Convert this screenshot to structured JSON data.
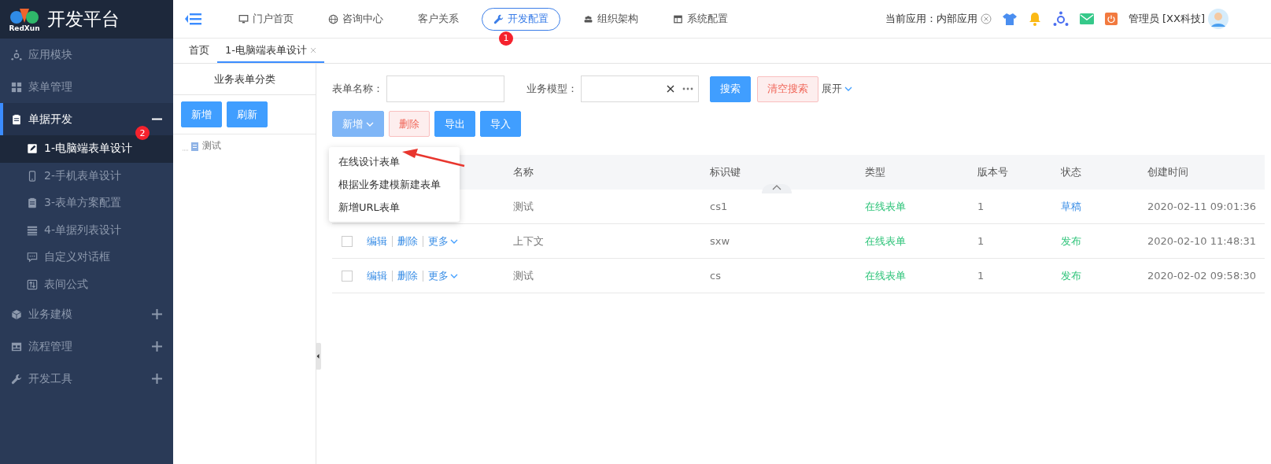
{
  "brand": {
    "logo_text": "RedXun",
    "title": "开发平台"
  },
  "nav": [
    {
      "label": "门户首页",
      "selected": false
    },
    {
      "label": "咨询中心",
      "selected": false
    },
    {
      "label": "客户关系",
      "selected": false
    },
    {
      "label": "开发配置",
      "selected": true,
      "badge": "1"
    },
    {
      "label": "组织架构",
      "selected": false
    },
    {
      "label": "系统配置",
      "selected": false
    }
  ],
  "current_app": {
    "label": "当前应用：内部应用"
  },
  "user": {
    "name": "管理员 [XX科技]"
  },
  "sidebar": [
    {
      "label": "应用模块",
      "kind": "link"
    },
    {
      "label": "菜单管理",
      "kind": "link"
    },
    {
      "label": "单据开发",
      "kind": "group",
      "expanded": true,
      "children": [
        {
          "label": "1-电脑端表单设计",
          "selected": true,
          "badge": "2"
        },
        {
          "label": "2-手机表单设计",
          "selected": false
        },
        {
          "label": "3-表单方案配置",
          "selected": false
        },
        {
          "label": "4-单据列表设计",
          "selected": false
        },
        {
          "label": "自定义对话框",
          "selected": false
        },
        {
          "label": "表间公式",
          "selected": false
        }
      ]
    },
    {
      "label": "业务建模",
      "kind": "group",
      "expanded": false
    },
    {
      "label": "流程管理",
      "kind": "group",
      "expanded": false
    },
    {
      "label": "开发工具",
      "kind": "group",
      "expanded": false
    }
  ],
  "page_tabs": [
    {
      "label": "首页",
      "selected": false,
      "closable": false
    },
    {
      "label": "1-电脑端表单设计",
      "selected": true,
      "closable": true
    }
  ],
  "tree_panel": {
    "title": "业务表单分类",
    "buttons": [
      "新增",
      "刷新"
    ],
    "nodes": [
      "测试"
    ]
  },
  "search": {
    "fields": [
      {
        "label": "表单名称：",
        "kind": "text"
      },
      {
        "label": "业务模型：",
        "kind": "picker"
      }
    ],
    "search_button": "搜索",
    "clear_button": "清空搜索",
    "expand_link": "展开"
  },
  "toolbar": [
    {
      "label": "新增",
      "kind": "dropdown"
    },
    {
      "label": "删除",
      "kind": "danger"
    },
    {
      "label": "导出",
      "kind": "primary"
    },
    {
      "label": "导入",
      "kind": "primary"
    }
  ],
  "add_menu": {
    "items": [
      "在线设计表单",
      "根据业务建模新建表单",
      "新增URL表单"
    ]
  },
  "table": {
    "columns": [
      "名称",
      "标识键",
      "类型",
      "版本号",
      "状态",
      "创建时间"
    ],
    "rows": [
      {
        "actions": [],
        "cells": [
          "测试",
          "cs1",
          "在线表单",
          "1"
        ],
        "status": {
          "label": "草稿",
          "color": "#3a8ee6"
        },
        "created": "2020-02-11 09:01:36"
      },
      {
        "checked": false,
        "actions": [
          "编辑",
          "删除",
          "更多"
        ],
        "cells": [
          "上下文",
          "sxw",
          "在线表单",
          "1"
        ],
        "status": {
          "label": "发布",
          "color": "#2fc47a"
        },
        "created": "2020-02-10 11:48:31"
      },
      {
        "checked": false,
        "actions": [
          "编辑",
          "删除",
          "更多"
        ],
        "cells": [
          "测试",
          "cs",
          "在线表单",
          "1"
        ],
        "status": {
          "label": "发布",
          "color": "#2fc47a"
        },
        "created": "2020-02-02 09:58:30"
      }
    ]
  }
}
